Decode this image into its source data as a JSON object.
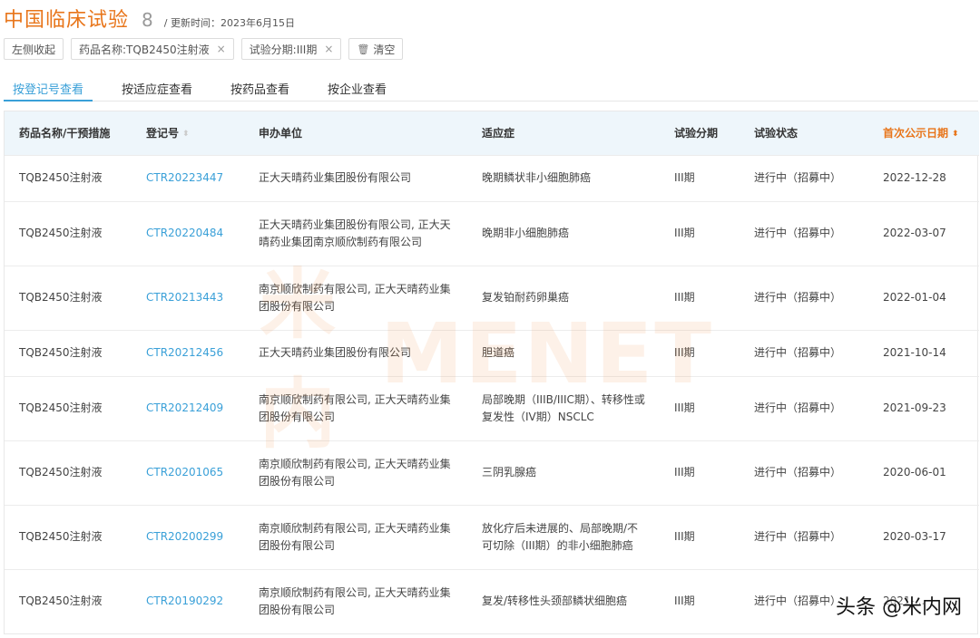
{
  "header": {
    "title": "中国临床试验",
    "count": "8",
    "update_text": "/ 更新时间：2023年6月15日"
  },
  "filters": {
    "collapse_label": "左侧收起",
    "drug_filter": "药品名称:TQB2450注射液",
    "phase_filter": "试验分期:III期",
    "clear_label": "清空",
    "remove_glyph": "×",
    "trash_glyph": "🗑"
  },
  "tabs": [
    "按登记号查看",
    "按适应症查看",
    "按药品查看",
    "按企业查看"
  ],
  "table": {
    "columns": [
      "药品名称/干预措施",
      "登记号",
      "申办单位",
      "适应症",
      "试验分期",
      "试验状态",
      "首次公示日期"
    ],
    "sort_glyph_idle": "⬍",
    "sort_glyph_active": "⬍",
    "rows": [
      {
        "drug": "TQB2450注射液",
        "id": "CTR20223447",
        "sponsor": "正大天晴药业集团股份有限公司",
        "indication": "晚期鳞状非小细胞肺癌",
        "phase": "III期",
        "status": "进行中（招募中）",
        "date": "2022-12-28"
      },
      {
        "drug": "TQB2450注射液",
        "id": "CTR20220484",
        "sponsor": "正大天晴药业集团股份有限公司, 正大天晴药业集团南京顺欣制药有限公司",
        "indication": "晚期非小细胞肺癌",
        "phase": "III期",
        "status": "进行中（招募中）",
        "date": "2022-03-07"
      },
      {
        "drug": "TQB2450注射液",
        "id": "CTR20213443",
        "sponsor": "南京顺欣制药有限公司, 正大天晴药业集团股份有限公司",
        "indication": "复发铂耐药卵巢癌",
        "phase": "III期",
        "status": "进行中（招募中）",
        "date": "2022-01-04"
      },
      {
        "drug": "TQB2450注射液",
        "id": "CTR20212456",
        "sponsor": "正大天晴药业集团股份有限公司",
        "indication": "胆道癌",
        "phase": "III期",
        "status": "进行中（招募中）",
        "date": "2021-10-14"
      },
      {
        "drug": "TQB2450注射液",
        "id": "CTR20212409",
        "sponsor": "南京顺欣制药有限公司, 正大天晴药业集团股份有限公司",
        "indication": "局部晚期（IIIB/IIIC期）、转移性或复发性（IV期）NSCLC",
        "phase": "III期",
        "status": "进行中（招募中）",
        "date": "2021-09-23"
      },
      {
        "drug": "TQB2450注射液",
        "id": "CTR20201065",
        "sponsor": "南京顺欣制药有限公司, 正大天晴药业集团股份有限公司",
        "indication": "三阴乳腺癌",
        "phase": "III期",
        "status": "进行中（招募中）",
        "date": "2020-06-01"
      },
      {
        "drug": "TQB2450注射液",
        "id": "CTR20200299",
        "sponsor": "南京顺欣制药有限公司, 正大天晴药业集团股份有限公司",
        "indication": "放化疗后未进展的、局部晚期/不可切除（III期）的非小细胞肺癌",
        "phase": "III期",
        "status": "进行中（招募中）",
        "date": "2020-03-17"
      },
      {
        "drug": "TQB2450注射液",
        "id": "CTR20190292",
        "sponsor": "南京顺欣制药有限公司, 正大天晴药业集团股份有限公司",
        "indication": "复发/转移性头颈部鳞状细胞癌",
        "phase": "III期",
        "status": "进行中（招募中）",
        "date": "2021-..."
      }
    ]
  },
  "watermark": {
    "cn": "米内",
    "en": "MENET"
  },
  "credit": "头条 @米内网",
  "colors": {
    "accent_orange": "#e8751a",
    "link_blue": "#3aa0d8",
    "header_bg": "#eef6fb"
  }
}
